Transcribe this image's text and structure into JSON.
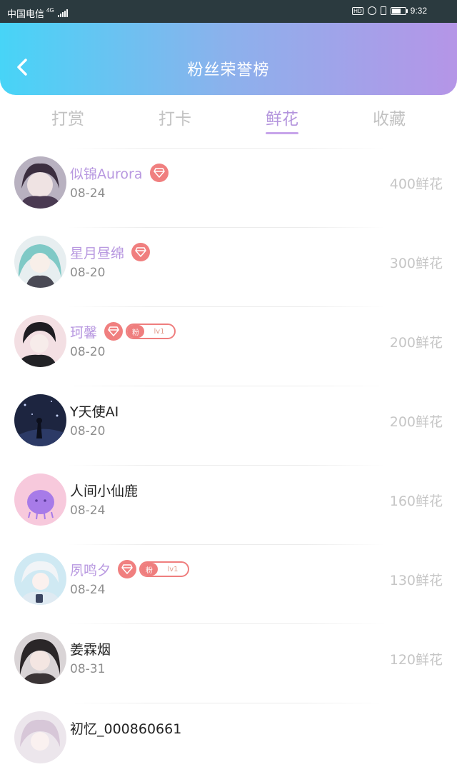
{
  "status_bar": {
    "carrier": "中国电信",
    "network": "4G",
    "hd_badge": "HD",
    "time": "9:32"
  },
  "header": {
    "title": "粉丝荣誉榜",
    "back_icon": "chevron-left-icon"
  },
  "tabs": [
    {
      "label": "打赏",
      "active": false
    },
    {
      "label": "打卡",
      "active": false
    },
    {
      "label": "鲜花",
      "active": true
    },
    {
      "label": "收藏",
      "active": false
    }
  ],
  "ranking": [
    {
      "name": "似锦Aurora",
      "date": "08-24",
      "amount": "400鲜花",
      "highlight": true,
      "diamond": true,
      "fan_badge": null
    },
    {
      "name": "星月昼绵",
      "date": "08-20",
      "amount": "300鲜花",
      "highlight": true,
      "diamond": true,
      "fan_badge": null
    },
    {
      "name": "珂馨",
      "date": "08-20",
      "amount": "200鲜花",
      "highlight": true,
      "diamond": true,
      "fan_badge": {
        "tag": "粉",
        "level": "lv1"
      }
    },
    {
      "name": "Y天使AI",
      "date": "08-20",
      "amount": "200鲜花",
      "highlight": false,
      "diamond": false,
      "fan_badge": null
    },
    {
      "name": "人间小仙鹿",
      "date": "08-24",
      "amount": "160鲜花",
      "highlight": false,
      "diamond": false,
      "fan_badge": null
    },
    {
      "name": "夙鸣夕",
      "date": "08-24",
      "amount": "130鲜花",
      "highlight": true,
      "diamond": true,
      "fan_badge": {
        "tag": "粉",
        "level": "lv1"
      }
    },
    {
      "name": "姜霖烟",
      "date": "08-31",
      "amount": "120鲜花",
      "highlight": false,
      "diamond": false,
      "fan_badge": null
    },
    {
      "name": "初忆_000860661",
      "date": "",
      "amount": "",
      "highlight": false,
      "diamond": false,
      "fan_badge": null
    }
  ],
  "colors": {
    "header_gradient_start": "#47d4f7",
    "header_gradient_end": "#b595e7",
    "active_tab": "#b495dd",
    "highlight_name": "#b898e0",
    "badge_red": "#ef7e7e",
    "amount_gray": "#c6c6c6"
  }
}
